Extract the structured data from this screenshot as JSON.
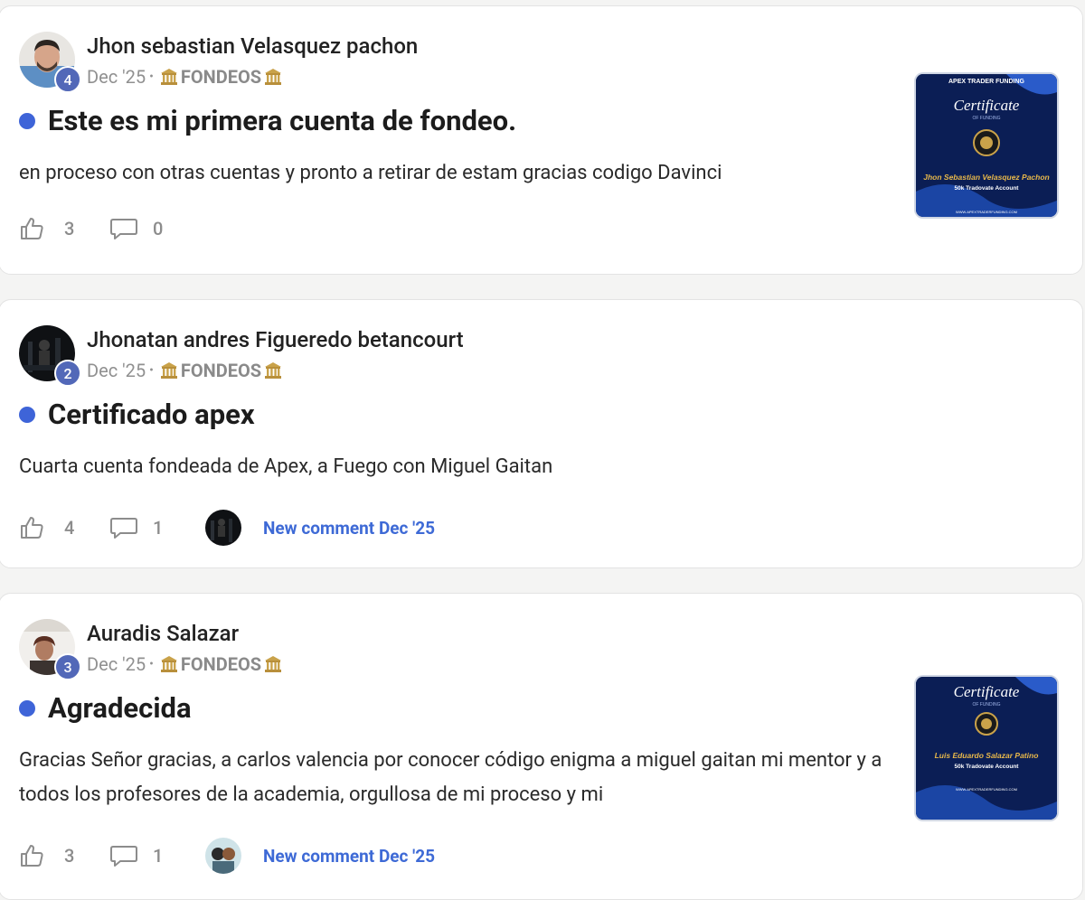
{
  "posts": [
    {
      "author": "Jhon sebastian Velasquez pachon",
      "level": "4",
      "date": "Dec '25",
      "category": "FONDEOS",
      "title": "Este es mi primera cuenta de fondeo.",
      "body": "en proceso con otras cuentas y pronto a retirar de estam gracias codigo Davinci",
      "likes": "3",
      "comments": "0",
      "has_thumbnail": true
    },
    {
      "author": "Jhonatan andres Figueredo betancourt",
      "level": "2",
      "date": "Dec '25",
      "category": "FONDEOS",
      "title": "Certificado apex",
      "body": "Cuarta cuenta fondeada de Apex, a Fuego con Miguel Gaitan",
      "likes": "4",
      "comments": "1",
      "new_comment": "New comment Dec '25",
      "has_thumbnail": false
    },
    {
      "author": "Auradis Salazar",
      "level": "3",
      "date": "Dec '25",
      "category": "FONDEOS",
      "title": "Agradecida",
      "body": "Gracias Señor gracias, a carlos valencia por conocer código enigma a miguel gaitan mi mentor y a todos los profesores de la academia, orgullosa de mi proceso y mi",
      "likes": "3",
      "comments": "1",
      "new_comment": "New comment Dec '25",
      "has_thumbnail": true
    }
  ],
  "thumbnails": [
    {
      "brand": "APEX TRADER FUNDING",
      "heading": "Certificate",
      "sub": "OF FUNDING",
      "name": "Jhon Sebastian Velasquez Pachon",
      "account": "50k Tradovate Account",
      "url": "WWW.APEXTRADERFUNDING.COM"
    },
    {
      "heading": "Certificate",
      "sub": "OF FUNDING",
      "name": "Luis Eduardo Salazar Patino",
      "account": "50k Tradovate Account",
      "url": "WWW.APEXTRADERFUNDING.COM"
    }
  ],
  "colors": {
    "accent": "#3e64d8",
    "link": "#3e6ad6",
    "level_badge": "#5268b8",
    "muted": "#8c8c8c",
    "certificate_bg": "#0b1e55"
  },
  "icons": {
    "like": "thumbs-up-icon",
    "comment": "comment-bubble-icon",
    "category": "bank-icon"
  }
}
